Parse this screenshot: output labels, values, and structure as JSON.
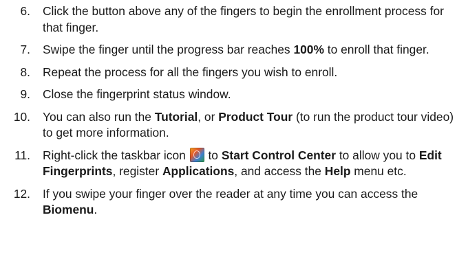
{
  "steps": [
    {
      "num": "6.",
      "parts": [
        {
          "t": "Click the button above any of the fingers to begin the enrollment process for that finger."
        }
      ]
    },
    {
      "num": "7.",
      "parts": [
        {
          "t": "Swipe the finger until the progress bar reaches "
        },
        {
          "t": "100%",
          "bold": true
        },
        {
          "t": " to enroll that finger."
        }
      ]
    },
    {
      "num": "8.",
      "parts": [
        {
          "t": "Repeat the process for all the fingers you wish to enroll."
        }
      ]
    },
    {
      "num": "9.",
      "parts": [
        {
          "t": "Close the fingerprint status window."
        }
      ]
    },
    {
      "num": "10.",
      "parts": [
        {
          "t": "You can also run the "
        },
        {
          "t": "Tutorial",
          "bold": true
        },
        {
          "t": ", or "
        },
        {
          "t": "Product Tour",
          "bold": true
        },
        {
          "t": " (to run the product tour video) to get more information."
        }
      ]
    },
    {
      "num": "11.",
      "parts": [
        {
          "t": "Right-click the taskbar icon "
        },
        {
          "icon": "fingerprint-taskbar-icon"
        },
        {
          "t": " to "
        },
        {
          "t": "Start Control Center",
          "bold": true
        },
        {
          "t": " to allow you to "
        },
        {
          "t": "Edit Fingerprints",
          "bold": true
        },
        {
          "t": ", register "
        },
        {
          "t": "Applications",
          "bold": true
        },
        {
          "t": ", and access the "
        },
        {
          "t": "Help",
          "bold": true
        },
        {
          "t": " menu etc."
        }
      ]
    },
    {
      "num": "12.",
      "parts": [
        {
          "t": "If you swipe your finger over the reader at any time you can access the "
        },
        {
          "t": "Biomenu",
          "bold": true
        },
        {
          "t": "."
        }
      ]
    }
  ]
}
